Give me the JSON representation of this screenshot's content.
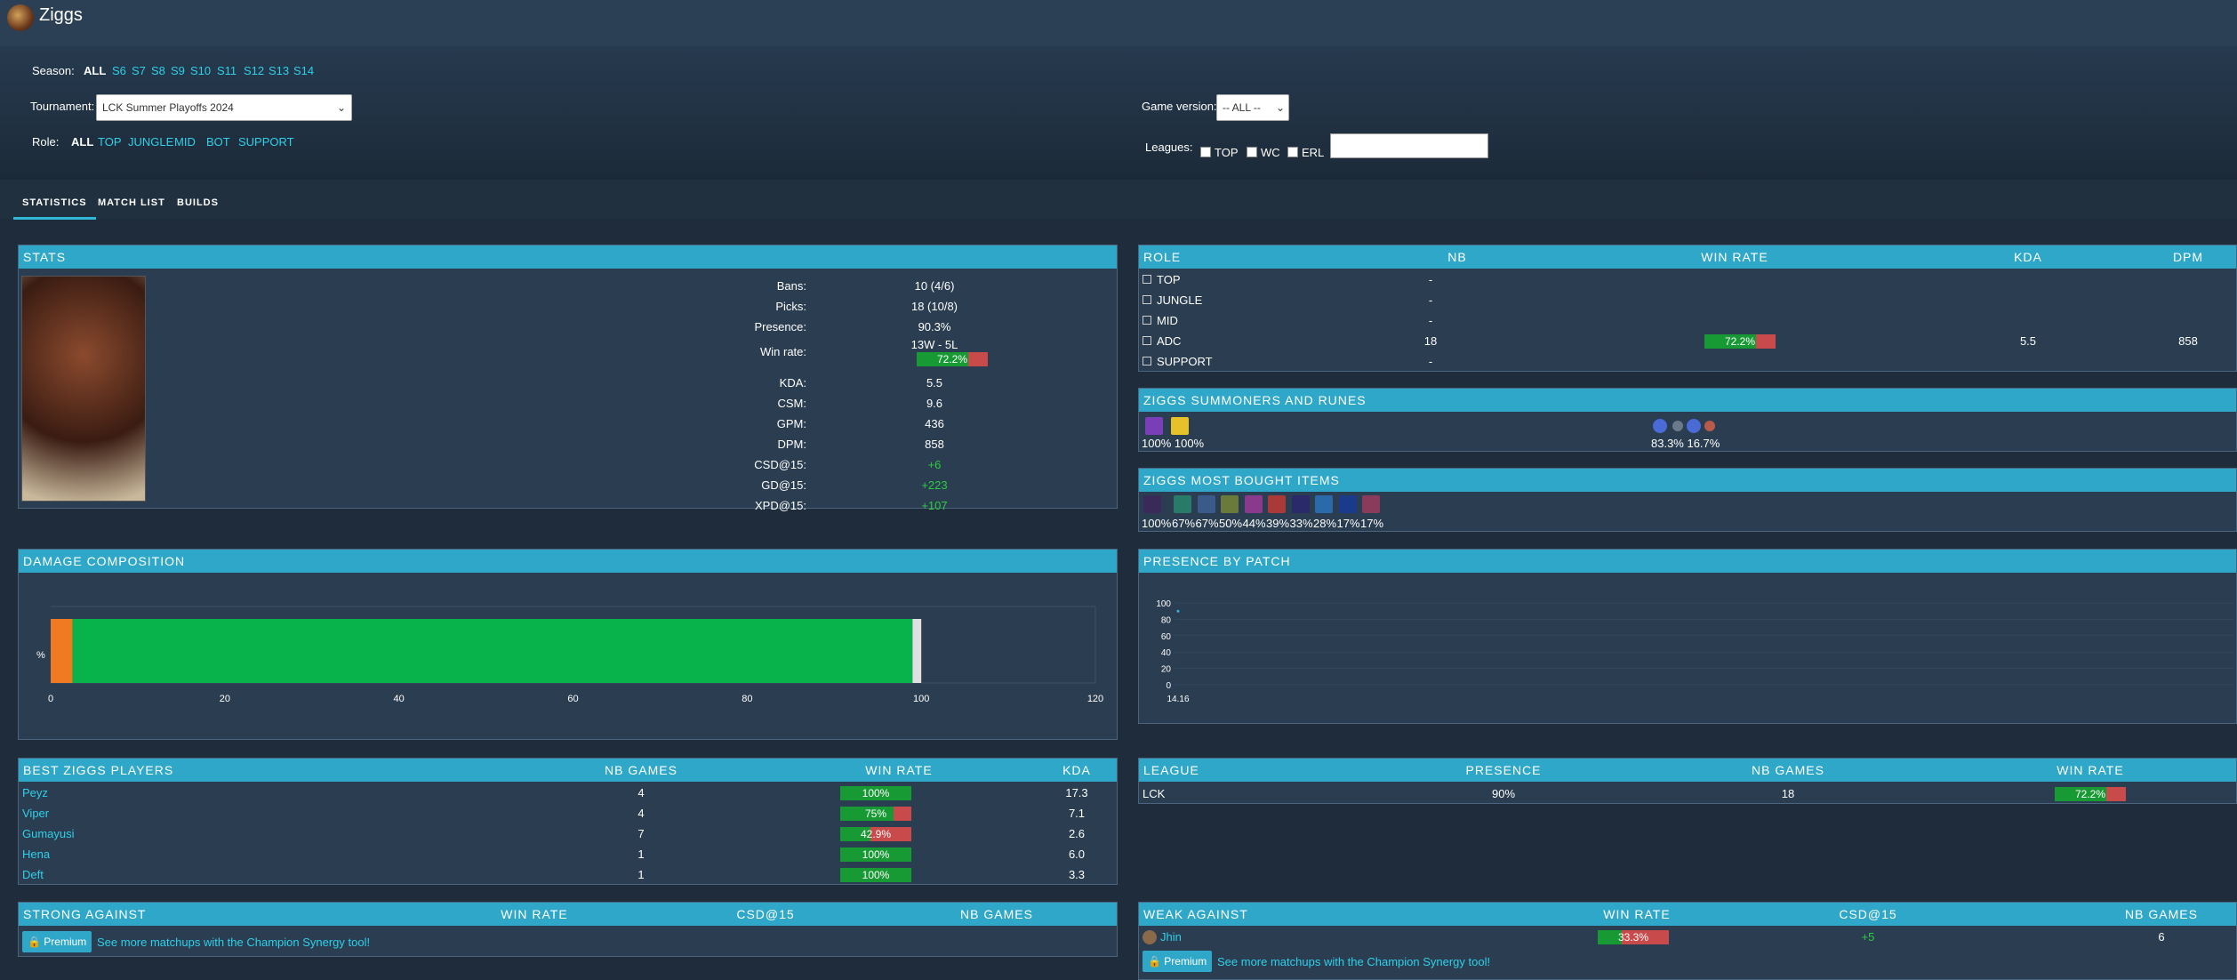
{
  "header": {
    "title": "Ziggs"
  },
  "filters": {
    "season_label": "Season:",
    "seasons": [
      "ALL",
      "S6",
      "S7",
      "S8",
      "S9",
      "S10",
      "S11",
      "S12",
      "S13",
      "S14"
    ],
    "tournament_label": "Tournament:",
    "tournament_value": "LCK Summer Playoffs 2024",
    "role_label": "Role:",
    "roles": [
      "ALL",
      "TOP",
      "JUNGLE",
      "MID",
      "BOT",
      "SUPPORT"
    ],
    "game_version_label": "Game version:",
    "game_version_value": "-- ALL --",
    "leagues_label": "Leagues:",
    "leagues": [
      "TOP",
      "WC",
      "ERL"
    ]
  },
  "tabs": [
    "STATISTICS",
    "MATCH LIST",
    "BUILDS"
  ],
  "stats": {
    "title": "STATS",
    "rows": [
      {
        "label": "Bans:",
        "value": "10 (4/6)"
      },
      {
        "label": "Picks:",
        "value": "18 (10/8)"
      },
      {
        "label": "Presence:",
        "value": "90.3%"
      },
      {
        "label": "Win rate:",
        "value": "13W - 5L",
        "bar": "72.2%",
        "pct": 72.2
      },
      {
        "label": "KDA:",
        "value": "5.5"
      },
      {
        "label": "CSM:",
        "value": "9.6"
      },
      {
        "label": "GPM:",
        "value": "436"
      },
      {
        "label": "DPM:",
        "value": "858"
      },
      {
        "label": "CSD@15:",
        "value": "+6"
      },
      {
        "label": "GD@15:",
        "value": "+223"
      },
      {
        "label": "XPD@15:",
        "value": "+107"
      }
    ]
  },
  "role_table": {
    "headers": [
      "ROLE",
      "NB",
      "WIN RATE",
      "KDA",
      "DPM"
    ],
    "rows": [
      {
        "role": "TOP",
        "nb": "-",
        "wr": "",
        "kda": "",
        "dpm": ""
      },
      {
        "role": "JUNGLE",
        "nb": "-",
        "wr": "",
        "kda": "",
        "dpm": ""
      },
      {
        "role": "MID",
        "nb": "-",
        "wr": "",
        "kda": "",
        "dpm": ""
      },
      {
        "role": "ADC",
        "nb": "18",
        "wr": "72.2%",
        "pct": 72.2,
        "kda": "5.5",
        "dpm": "858"
      },
      {
        "role": "SUPPORT",
        "nb": "-",
        "wr": "",
        "kda": "",
        "dpm": ""
      }
    ]
  },
  "summoners": {
    "title": "ZIGGS SUMMONERS AND RUNES",
    "spells_pct": "100% 100%",
    "runes_pct": "83.3% 16.7%",
    "colors": {
      "spell1": "#7a3fb8",
      "spell2": "#e6c12a",
      "rune": "#4a6ad6"
    }
  },
  "items": {
    "title": "ZIGGS MOST BOUGHT ITEMS",
    "pcts": [
      "100%",
      "67%",
      "67%",
      "50%",
      "44%",
      "39%",
      "33%",
      "28%",
      "17%",
      "17%"
    ]
  },
  "damage": {
    "title": "DAMAGE COMPOSITION",
    "ylabel": "%",
    "ticks": [
      "0",
      "20",
      "40",
      "60",
      "80",
      "100",
      "120"
    ]
  },
  "presence": {
    "title": "PRESENCE BY PATCH",
    "ticks": [
      "100",
      "80",
      "60",
      "40",
      "20",
      "0"
    ],
    "patch": "14.16"
  },
  "chart_data": [
    {
      "type": "bar",
      "title": "DAMAGE COMPOSITION",
      "orientation": "horizontal-stacked",
      "ylabel": "%",
      "xlim": [
        0,
        120
      ],
      "series": [
        {
          "values": [
            2.5
          ],
          "color": "#f07a22"
        },
        {
          "values": [
            96.5
          ],
          "color": "#07b34a"
        },
        {
          "values": [
            1.0
          ],
          "color": "#e0e0e0"
        }
      ]
    },
    {
      "type": "scatter",
      "title": "PRESENCE BY PATCH",
      "x": [
        "14.16"
      ],
      "y": [
        90
      ],
      "ylim": [
        0,
        100
      ]
    }
  ],
  "best_players": {
    "headers": [
      "BEST ZIGGS PLAYERS",
      "NB GAMES",
      "WIN RATE",
      "KDA"
    ],
    "rows": [
      {
        "name": "Peyz",
        "games": "4",
        "wr": "100%",
        "pct": 100,
        "kda": "17.3"
      },
      {
        "name": "Viper",
        "games": "4",
        "wr": "75%",
        "pct": 75,
        "kda": "7.1"
      },
      {
        "name": "Gumayusi",
        "games": "7",
        "wr": "42.9%",
        "pct": 42.9,
        "kda": "2.6"
      },
      {
        "name": "Hena",
        "games": "1",
        "wr": "100%",
        "pct": 100,
        "kda": "6.0"
      },
      {
        "name": "Deft",
        "games": "1",
        "wr": "100%",
        "pct": 100,
        "kda": "3.3"
      }
    ]
  },
  "league_table": {
    "headers": [
      "LEAGUE",
      "PRESENCE",
      "NB GAMES",
      "WIN RATE"
    ],
    "row": {
      "league": "LCK",
      "presence": "90%",
      "games": "18",
      "wr": "72.2%",
      "pct": 72.2
    }
  },
  "strong": {
    "headers": [
      "STRONG AGAINST",
      "WIN RATE",
      "CSD@15",
      "NB GAMES"
    ],
    "premium": "Premium",
    "cta": "See more matchups with the Champion Synergy tool!"
  },
  "weak": {
    "headers": [
      "WEAK AGAINST",
      "WIN RATE",
      "CSD@15",
      "NB GAMES"
    ],
    "row": {
      "champ": "Jhin",
      "wr": "33.3%",
      "pct": 33.3,
      "csd": "+5",
      "games": "6"
    },
    "premium": "Premium",
    "cta": "See more matchups with the Champion Synergy tool!"
  }
}
